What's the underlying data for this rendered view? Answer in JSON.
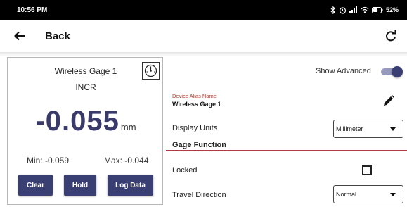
{
  "status_bar": {
    "time": "10:56 PM",
    "battery": "52%",
    "icons": [
      "bluetooth-icon",
      "alarm-icon",
      "signal-icon",
      "wifi-icon",
      "battery-icon"
    ]
  },
  "app_bar": {
    "back_label": "Back",
    "icons": [
      "back-arrow-icon",
      "refresh-icon"
    ]
  },
  "gage_card": {
    "name": "Wireless Gage 1",
    "mode": "INCR",
    "reading": "-0.055",
    "unit": "mm",
    "min_label": "Min: -0.059",
    "max_label": "Max: -0.044",
    "buttons": {
      "clear": "Clear",
      "hold": "Hold",
      "log": "Log Data"
    }
  },
  "settings": {
    "show_advanced_label": "Show Advanced",
    "show_advanced_enabled": true,
    "alias_label": "Device Alias Name",
    "alias_value": "Wireless Gage 1",
    "display_units_label": "Display Units",
    "display_units_value": "Millimeter",
    "gage_function_title": "Gage Function",
    "locked_label": "Locked",
    "locked_checked": false,
    "travel_direction_label": "Travel Direction",
    "travel_direction_value": "Normal"
  },
  "colors": {
    "primary": "#3a3f73",
    "reading": "#3a3a6a",
    "alias_label": "#c0392b",
    "section_line": "#b03a48",
    "toggle_track": "#9799bd"
  }
}
